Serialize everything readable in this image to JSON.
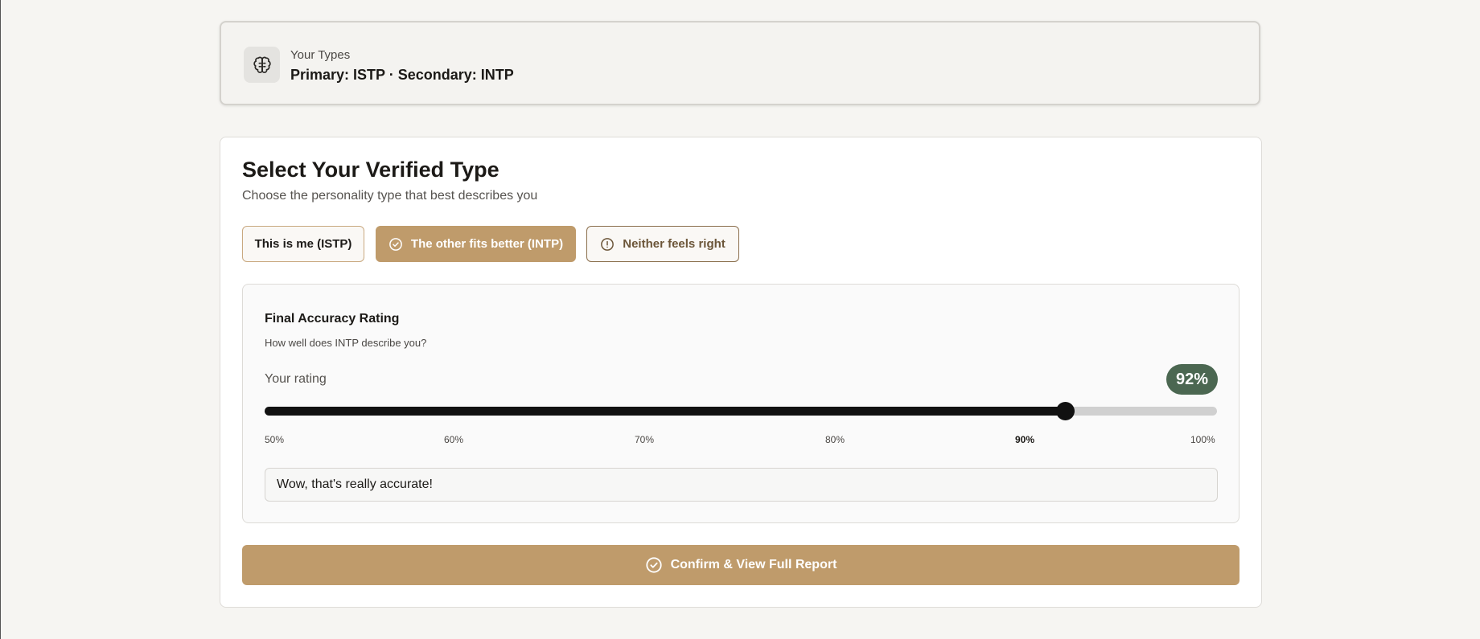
{
  "types_card": {
    "label": "Your Types",
    "value": "Primary: ISTP · Secondary: INTP",
    "icon": "brain-icon"
  },
  "main": {
    "title": "Select Your Verified Type",
    "subtitle": "Choose the personality type that best describes you",
    "choices": [
      {
        "label": "This is me (ISTP)",
        "selected": false
      },
      {
        "label": "The other fits better (INTP)",
        "selected": true,
        "icon": "check-circle-icon"
      },
      {
        "label": "Neither feels right",
        "selected": false,
        "icon": "alert-circle-icon"
      }
    ]
  },
  "rating": {
    "title": "Final Accuracy Rating",
    "question": "How well does INTP describe you?",
    "your_rating_label": "Your rating",
    "value_label": "92%",
    "value": 92,
    "min": 50,
    "max": 100,
    "ticks": [
      "50%",
      "60%",
      "70%",
      "80%",
      "90%",
      "100%"
    ],
    "active_tick": "90%",
    "feedback_text": "Wow, that's really accurate!"
  },
  "confirm": {
    "label": "Confirm & View Full Report",
    "icon": "check-circle-icon"
  },
  "colors": {
    "accent": "#bf9b6b",
    "badge": "#4b6751",
    "background": "#f6f5f2"
  }
}
